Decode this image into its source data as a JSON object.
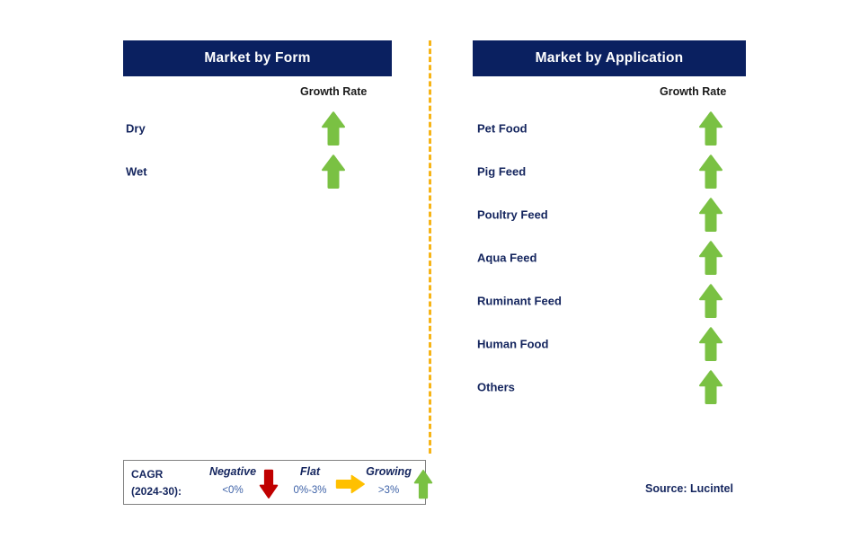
{
  "chart_data": {
    "type": "table",
    "title": "Market Growth Rate by Segment",
    "panels": [
      {
        "title": "Market by Form",
        "column_header": "Growth Rate",
        "categories": [
          "Dry",
          "Wet"
        ],
        "values": [
          "Growing",
          "Growing"
        ],
        "arrow_icons": [
          "arrow-up-green",
          "arrow-up-green"
        ]
      },
      {
        "title": "Market by Application",
        "column_header": "Growth Rate",
        "categories": [
          "Pet Food",
          "Pig Feed",
          "Poultry Feed",
          "Aqua Feed",
          "Ruminant Feed",
          "Human Food",
          "Others"
        ],
        "values": [
          "Growing",
          "Growing",
          "Growing",
          "Growing",
          "Growing",
          "Growing",
          "Growing"
        ],
        "arrow_icons": [
          "arrow-up-green",
          "arrow-up-green",
          "arrow-up-green",
          "arrow-up-green",
          "arrow-up-green",
          "arrow-up-green",
          "arrow-up-green"
        ]
      }
    ],
    "legend": {
      "title_line1": "CAGR",
      "title_line2": "(2024-30):",
      "entries": [
        {
          "name": "Negative",
          "range": "<0%",
          "icon": "arrow-down-red",
          "color": "#c00000"
        },
        {
          "name": "Flat",
          "range": "0%-3%",
          "icon": "arrow-right-orange",
          "color": "#ffc000"
        },
        {
          "name": "Growing",
          "range": ">3%",
          "icon": "arrow-up-green",
          "color": "#7ac143"
        }
      ]
    },
    "source": "Source: Lucintel",
    "colors": {
      "header_bar": "#0a2060",
      "label_text": "#14255e",
      "growth_arrow": "#7ac143",
      "negative_arrow": "#c00000",
      "flat_arrow": "#ffc000",
      "divider": "#f7b416",
      "legend_range_text": "#3f63a8"
    }
  },
  "panel_form": {
    "title": "Market by Form",
    "growth_rate_label": "Growth Rate",
    "rows": [
      {
        "label": "Dry"
      },
      {
        "label": "Wet"
      }
    ]
  },
  "panel_application": {
    "title": "Market by Application",
    "growth_rate_label": "Growth Rate",
    "rows": [
      {
        "label": "Pet Food"
      },
      {
        "label": "Pig Feed"
      },
      {
        "label": "Poultry Feed"
      },
      {
        "label": "Aqua Feed"
      },
      {
        "label": "Ruminant Feed"
      },
      {
        "label": "Human Food"
      },
      {
        "label": "Others"
      }
    ]
  },
  "legend": {
    "cagr_line1": "CAGR",
    "cagr_line2": "(2024-30):",
    "negative": {
      "name": "Negative",
      "range": "<0%"
    },
    "flat": {
      "name": "Flat",
      "range": "0%-3%"
    },
    "growing": {
      "name": "Growing",
      "range": ">3%"
    }
  },
  "source": {
    "text": "Source: Lucintel"
  }
}
